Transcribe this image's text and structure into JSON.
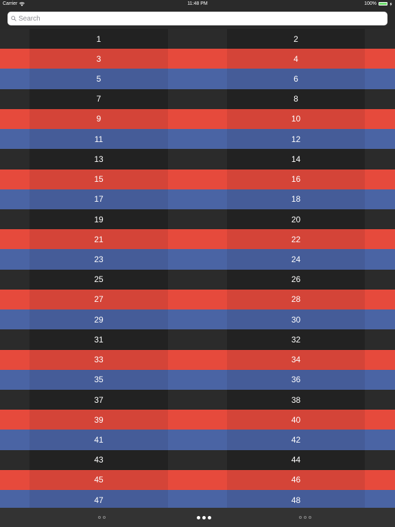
{
  "status_bar": {
    "carrier": "Carrier",
    "time": "11:48 PM",
    "battery": "100%",
    "battery_level": 1.0
  },
  "search": {
    "placeholder": "Search",
    "value": ""
  },
  "grid": {
    "row_colors": [
      "black",
      "red",
      "blue"
    ],
    "rows": [
      [
        "1",
        "2"
      ],
      [
        "3",
        "4"
      ],
      [
        "5",
        "6"
      ],
      [
        "7",
        "8"
      ],
      [
        "9",
        "10"
      ],
      [
        "11",
        "12"
      ],
      [
        "13",
        "14"
      ],
      [
        "15",
        "16"
      ],
      [
        "17",
        "18"
      ],
      [
        "19",
        "20"
      ],
      [
        "21",
        "22"
      ],
      [
        "23",
        "24"
      ],
      [
        "25",
        "26"
      ],
      [
        "27",
        "28"
      ],
      [
        "29",
        "30"
      ],
      [
        "31",
        "32"
      ],
      [
        "33",
        "34"
      ],
      [
        "35",
        "36"
      ],
      [
        "37",
        "38"
      ],
      [
        "39",
        "40"
      ],
      [
        "41",
        "42"
      ],
      [
        "43",
        "44"
      ],
      [
        "45",
        "46"
      ],
      [
        "47",
        "48"
      ]
    ]
  },
  "tabs": [
    {
      "name": "tab-two-dots",
      "dots": 2,
      "selected": false
    },
    {
      "name": "tab-three-dots-filled",
      "dots": 3,
      "selected": true
    },
    {
      "name": "tab-three-dots-outline",
      "dots": 3,
      "selected": false
    }
  ],
  "colors": {
    "black": "#222222",
    "red": "#e64a3c",
    "blue": "#4a64a4",
    "battery": "#6adb6a"
  }
}
